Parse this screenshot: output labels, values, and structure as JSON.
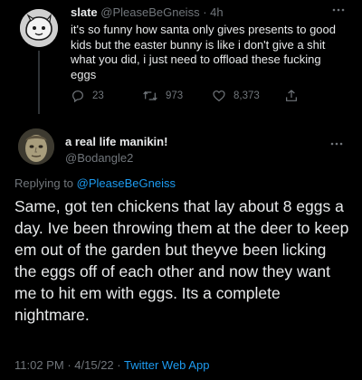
{
  "original_tweet": {
    "display_name": "slate",
    "handle": "@PleaseBeGneiss",
    "separator": "·",
    "time_ago": "4h",
    "text": "it's so funny how santa only gives presents to good kids but the easter bunny is like i don't give a shit what you did, i just need to offload these fucking eggs",
    "more_icon": "more-horizontal-icon",
    "actions": {
      "replies": "23",
      "retweets": "973",
      "likes": "8,373"
    }
  },
  "reply_tweet": {
    "display_name": "a real life manikin!",
    "handle": "@Bodangle2",
    "replying_prefix": "Replying to",
    "replying_to": "@PleaseBeGneiss",
    "text": "Same, got ten chickens that lay about 8 eggs a day. Ive been throwing them at the deer to keep em out of the garden but theyve been licking the eggs off of each other and now they want me to hit em with eggs. Its a complete nightmare.",
    "time": "11:02 PM",
    "separator": "·",
    "date": "4/15/22",
    "source": "Twitter Web App"
  },
  "colors": {
    "background": "#000000",
    "text": "#e7e9ea",
    "muted": "#71767b",
    "accent": "#1d9bf0",
    "divider": "#2f3336"
  }
}
